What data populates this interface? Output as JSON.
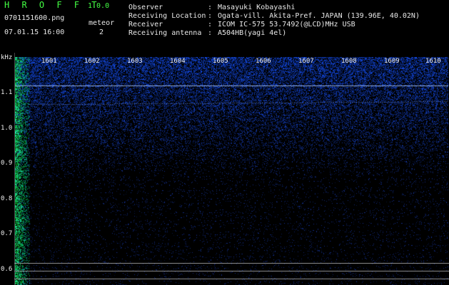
{
  "header": {
    "app_title": "H R O F F T",
    "app_version": "1.0.0",
    "filename": "0701151600.png",
    "datetime": "07.01.15 16:00",
    "meteor_label": "meteor",
    "meteor_count": "2",
    "fields": [
      {
        "key": "Observer",
        "sep": ":",
        "value": "Masayuki Kobayashi"
      },
      {
        "key": "Receiving Location",
        "sep": ":",
        "value": "Ogata-vill. Akita-Pref. JAPAN (139.96E, 40.02N)"
      },
      {
        "key": "Receiver",
        "sep": ":",
        "value": "ICOM IC-575 53.7492(@LCD)MHz USB"
      },
      {
        "key": "Receiving antenna",
        "sep": ":",
        "value": "A504HB(yagi 4el)"
      }
    ]
  },
  "spectrogram": {
    "y_unit": "kHz",
    "y_ticks": [
      "1.1",
      "1.0",
      "0.9",
      "0.8",
      "0.7",
      "0.6"
    ],
    "x_ticks": [
      "1601",
      "1602",
      "1603",
      "1604",
      "1605",
      "1606",
      "1607",
      "1608",
      "1609",
      "1610"
    ],
    "colors": {
      "background": "#000000",
      "noise": "#2040ff",
      "edge": "#40ff80",
      "label": "#44ff44"
    }
  }
}
